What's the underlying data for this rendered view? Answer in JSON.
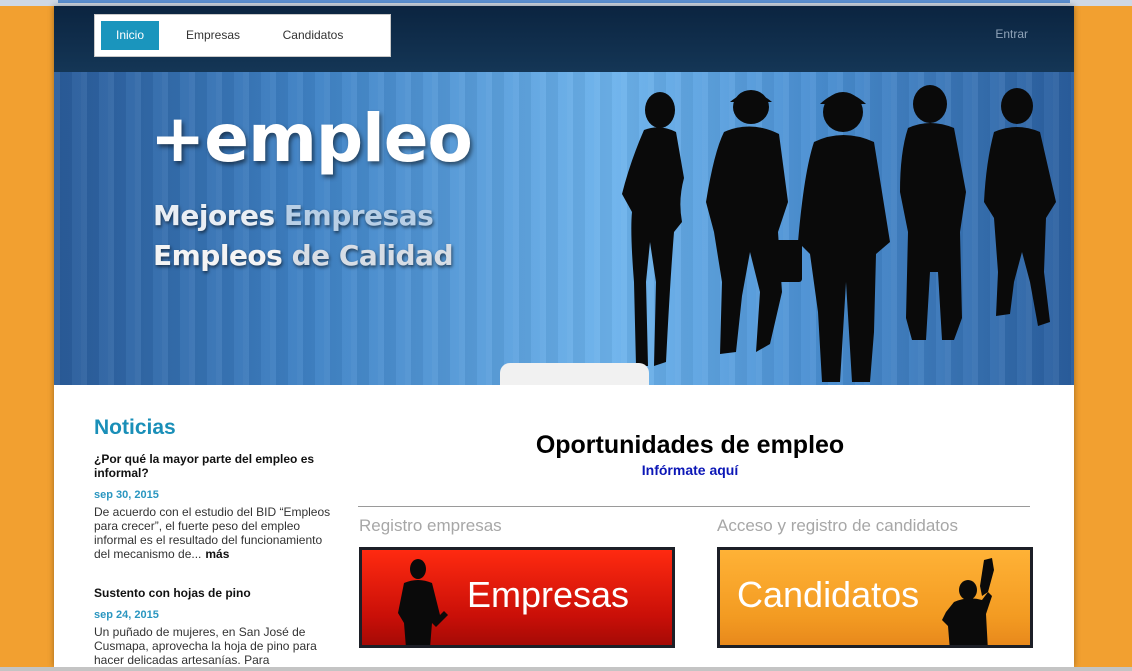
{
  "nav": {
    "items": [
      {
        "label": "Inicio",
        "active": true
      },
      {
        "label": "Empresas",
        "active": false
      },
      {
        "label": "Candidatos",
        "active": false
      }
    ],
    "login_label": "Entrar"
  },
  "hero": {
    "brand": "+empleo",
    "tagline1_a": "Mejores",
    "tagline1_b": "Empresas",
    "tagline2_a": "Empleos",
    "tagline2_b": "de Calidad"
  },
  "news": {
    "title": "Noticias",
    "items": [
      {
        "headline": "¿Por qué la mayor parte del empleo es informal?",
        "date": "sep 30, 2015",
        "excerpt": "De acuerdo con el estudio del BID “Empleos para crecer”, el fuerte peso del empleo informal es el resultado del funcionamiento del mecanismo de...",
        "more": "más"
      },
      {
        "headline": "Sustento con hojas de pino",
        "date": "sep 24, 2015",
        "excerpt": "Un puñado de mujeres, en San José de Cusmapa, aprovecha la hoja de pino para hacer delicadas artesanías. Para",
        "more": ""
      }
    ]
  },
  "main": {
    "title": "Oportunidades de empleo",
    "link": "Infórmate aquí",
    "companies_label": "Registro empresas",
    "companies_button": "Empresas",
    "candidates_label": "Acceso y registro de candidatos",
    "candidates_button": "Candidatos"
  },
  "colors": {
    "accent": "#1a95bd",
    "page_background": "#f2a030",
    "nav_background": "#0f2c4a",
    "companies_button": "#e8180c",
    "candidates_button": "#f7a229"
  }
}
